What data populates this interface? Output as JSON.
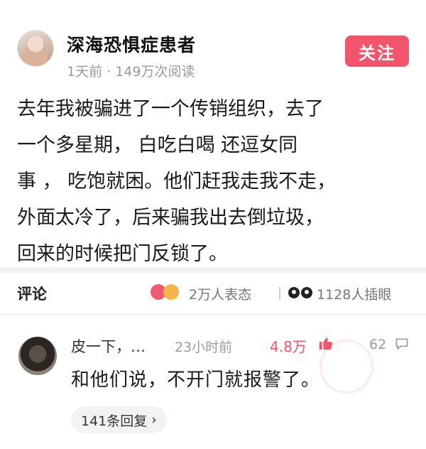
{
  "post": {
    "author": "深海恐惧症患者",
    "meta": "1天前 · 149万次阅读",
    "follow_label": "关注",
    "body": "去年我被骗进了一个传销组织，去了\n一个多星期，   白吃白喝  还逗女同\n事  ，  吃饱就困。他们赶我走我不走，\n外面太冷了，后来骗我出去倒垃圾，\n回来的时候把门反锁了。"
  },
  "comments_bar": {
    "label": "评论",
    "reactions": "2万人表态",
    "views": "1128人插眼"
  },
  "comment": {
    "name": "皮一下，…",
    "time": "23小时前",
    "likes": "4.8万",
    "replies": "62",
    "text": "和他们说，不开门就报警了。",
    "replies_pill": "141条回复",
    "pill_chevron": "›"
  },
  "colors": {
    "accent": "#f2546b",
    "muted": "#9a9a9a"
  }
}
